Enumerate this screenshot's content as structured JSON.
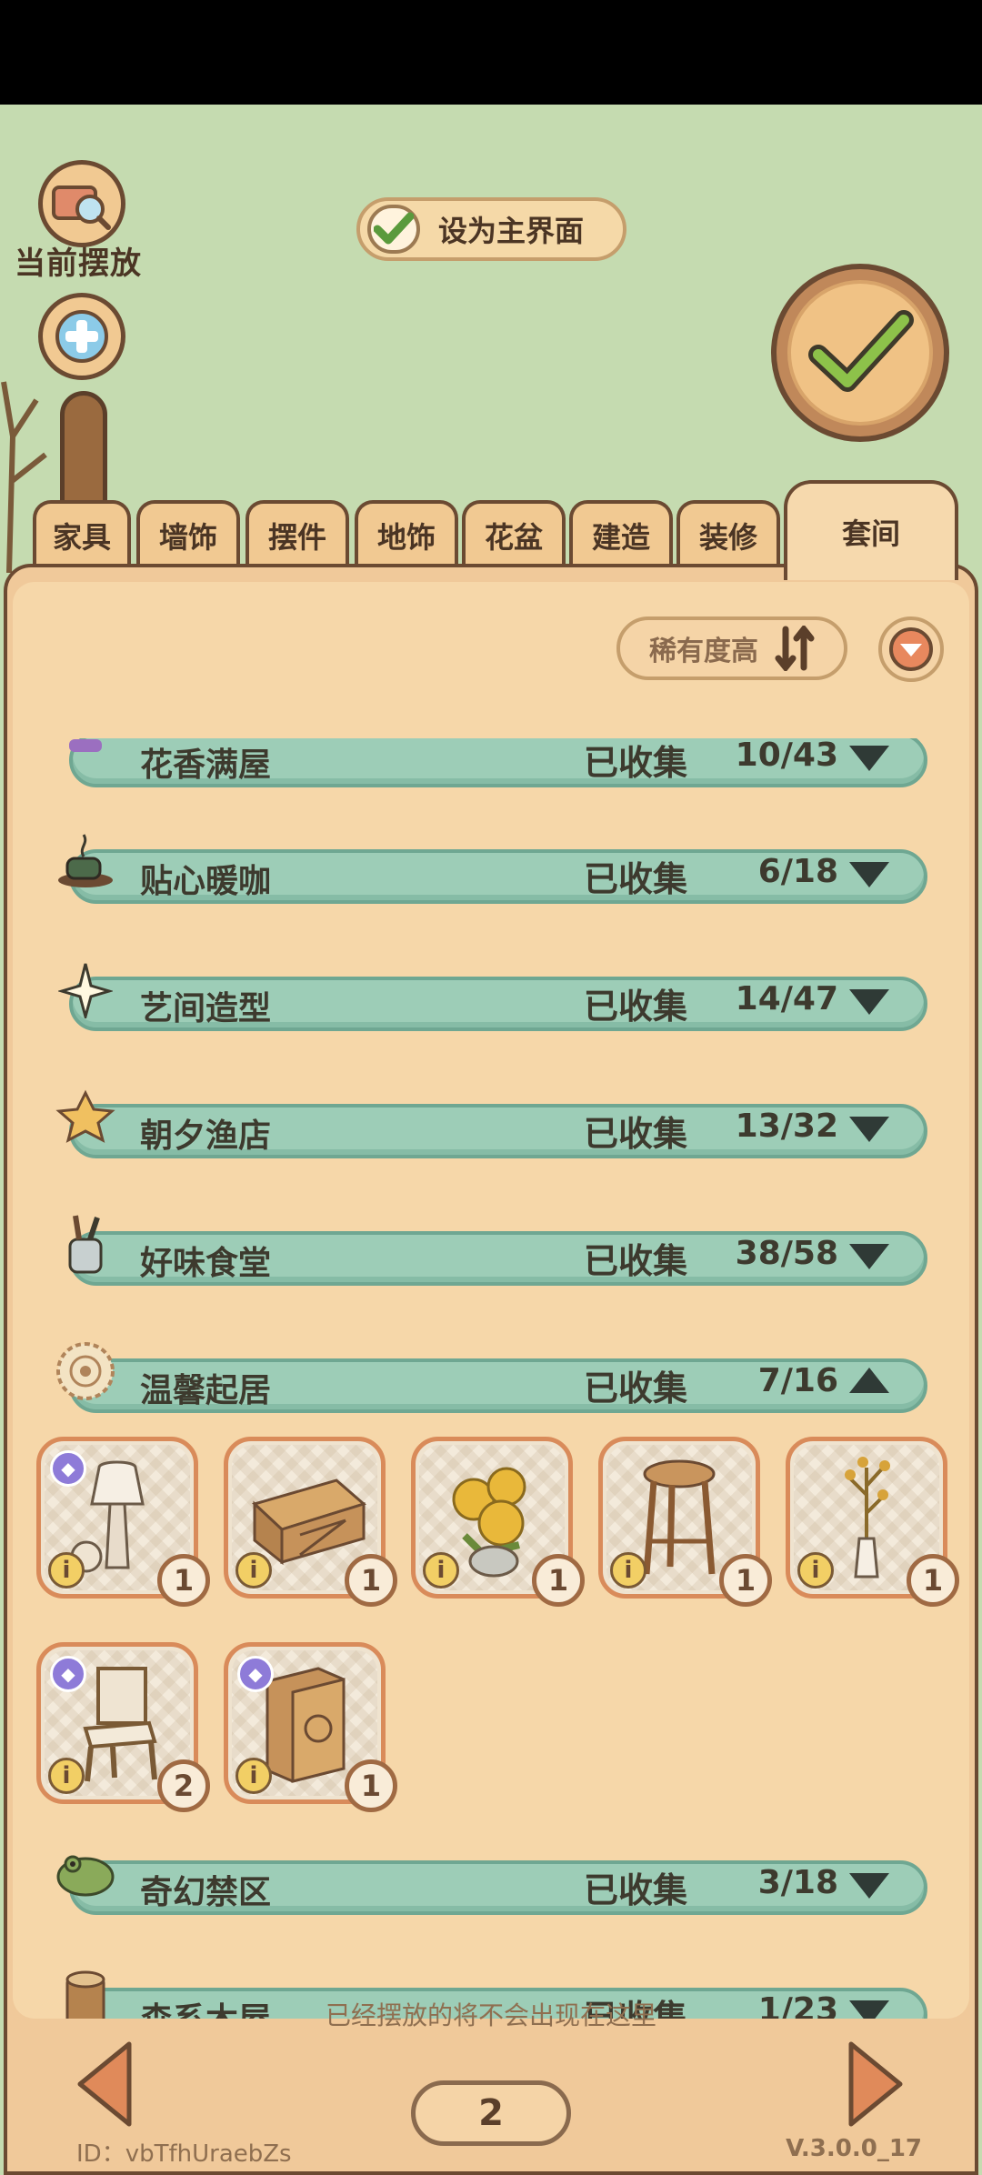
{
  "top_actions": {
    "current_label": "当前摆放",
    "set_main_label": "设为主界面"
  },
  "tabs": [
    {
      "label": "家具"
    },
    {
      "label": "墙饰"
    },
    {
      "label": "摆件"
    },
    {
      "label": "地饰"
    },
    {
      "label": "花盆"
    },
    {
      "label": "建造"
    },
    {
      "label": "装修"
    },
    {
      "label": "套间"
    }
  ],
  "active_tab": "套间",
  "sort": {
    "label": "稀有度高"
  },
  "sets": [
    {
      "name": "花香满屋",
      "collected_label": "已收集",
      "count": "10/43",
      "icon": "flower-icon",
      "expanded": false
    },
    {
      "name": "贴心暖咖",
      "collected_label": "已收集",
      "count": "6/18",
      "icon": "coffee-cup-icon",
      "expanded": false
    },
    {
      "name": "艺间造型",
      "collected_label": "已收集",
      "count": "14/47",
      "icon": "sparkle-icon",
      "expanded": false
    },
    {
      "name": "朝夕渔店",
      "collected_label": "已收集",
      "count": "13/32",
      "icon": "star-icon",
      "expanded": false
    },
    {
      "name": "好味食堂",
      "collected_label": "已收集",
      "count": "38/58",
      "icon": "utensils-icon",
      "expanded": false
    },
    {
      "name": "温馨起居",
      "collected_label": "已收集",
      "count": "7/16",
      "icon": "doily-icon",
      "expanded": true
    },
    {
      "name": "奇幻禁区",
      "collected_label": "已收集",
      "count": "3/18",
      "icon": "frog-icon",
      "expanded": false
    },
    {
      "name": "森系木屋",
      "collected_label": "已收集",
      "count": "1/23",
      "icon": "log-icon",
      "expanded": false
    }
  ],
  "items": [
    {
      "icon": "lamp-icon",
      "qty": "1",
      "new": true
    },
    {
      "icon": "wooden-table-icon",
      "qty": "1",
      "new": false
    },
    {
      "icon": "sunflower-icon",
      "qty": "1",
      "new": false
    },
    {
      "icon": "stool-icon",
      "qty": "1",
      "new": false
    },
    {
      "icon": "vase-branch-icon",
      "qty": "1",
      "new": false
    },
    {
      "icon": "chair-icon",
      "qty": "2",
      "new": true
    },
    {
      "icon": "cabinet-icon",
      "qty": "1",
      "new": true
    }
  ],
  "footer": {
    "hint": "已经摆放的将不会出现在这里",
    "page": "2",
    "user_id": "ID：vbTfhUraebZs",
    "version": "V.3.0.0_17"
  },
  "colors": {
    "background": "#c5dbb0",
    "panel": "#f0c99a",
    "set_bar": "#9dcdb7",
    "border": "#6b4a32"
  }
}
